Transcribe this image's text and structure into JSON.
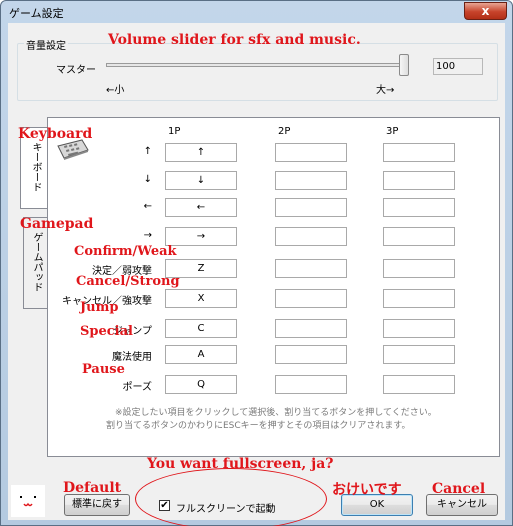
{
  "window": {
    "title": "ゲーム設定",
    "close_label": "x"
  },
  "volume": {
    "group_label": "音量設定",
    "master_label": "マスター",
    "value": "100",
    "level": 1.0,
    "min_label": "←小",
    "max_label": "大→"
  },
  "tabs": [
    {
      "label": "キーボード",
      "selected": true
    },
    {
      "label": "ゲームパッド",
      "selected": false
    }
  ],
  "columns": [
    "1P",
    "2P",
    "3P"
  ],
  "rows": [
    {
      "label": "↑",
      "p1": "↑",
      "p2": "",
      "p3": ""
    },
    {
      "label": "↓",
      "p1": "↓",
      "p2": "",
      "p3": ""
    },
    {
      "label": "←",
      "p1": "←",
      "p2": "",
      "p3": ""
    },
    {
      "label": "→",
      "p1": "→",
      "p2": "",
      "p3": ""
    },
    {
      "label": "決定／弱攻撃",
      "p1": "Z",
      "p2": "",
      "p3": ""
    },
    {
      "label": "キャンセル／強攻撃",
      "p1": "X",
      "p2": "",
      "p3": ""
    },
    {
      "label": "ジャンプ",
      "p1": "C",
      "p2": "",
      "p3": ""
    },
    {
      "label": "魔法使用",
      "p1": "A",
      "p2": "",
      "p3": ""
    },
    {
      "label": "ポーズ",
      "p1": "Q",
      "p2": "",
      "p3": ""
    }
  ],
  "note": {
    "line1": "※設定したい項目をクリックして選択後、割り当てるボタンを押してください。",
    "line2": "割り当てるボタンのかわりにESCキーを押すとその項目はクリアされます。"
  },
  "buttons": {
    "default": "標準に戻す",
    "ok": "OK",
    "cancel": "キャンセル"
  },
  "fullscreen": {
    "label": "フルスクリーンで起動",
    "checked": true,
    "mark": "✔"
  },
  "face": {
    "text": "·  ·\n‿"
  },
  "annotations": {
    "volume": "Volume slider for sfx and music.",
    "keyboard": "Keyboard",
    "gamepad": "Gamepad",
    "confirm": "Confirm/Weak",
    "cancel_strong": "Cancel/Strong",
    "jump": "Jump",
    "special": "Special",
    "pause": "Pause",
    "fullscreen": "You want fullscreen, ja?",
    "default": "Default",
    "okay": "おけいです",
    "cancel": "Cancel"
  },
  "colors": {
    "annotation": "#e0161b",
    "frame": "#b9cde3",
    "face": "#000000"
  }
}
